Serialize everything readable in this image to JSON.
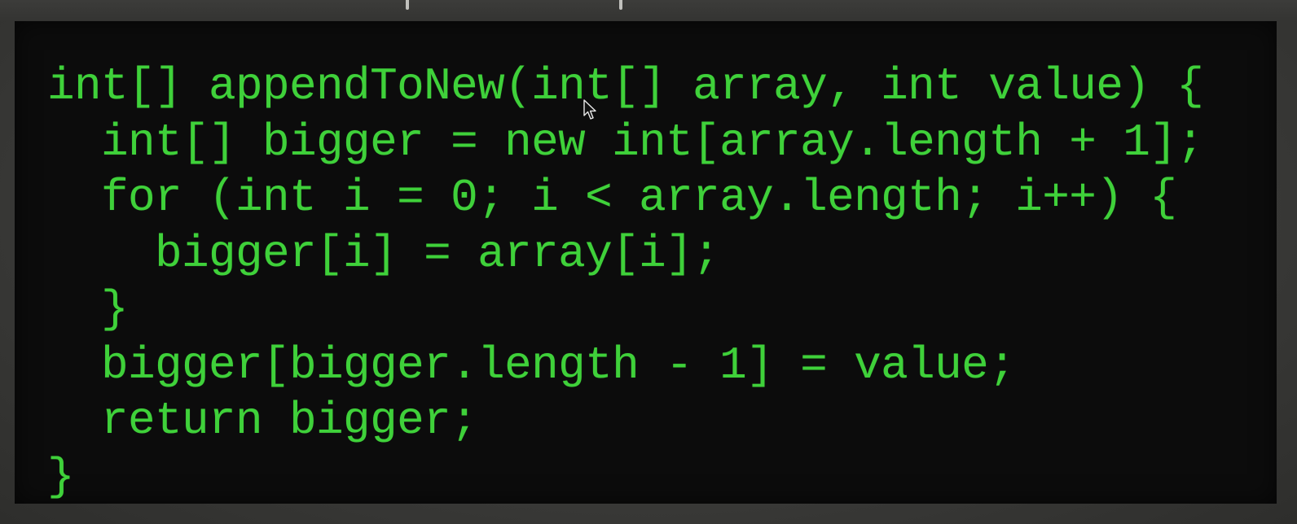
{
  "code": {
    "lines": [
      "int[] appendToNew(int[] array, int value) {",
      "  int[] bigger = new int[array.length + 1];",
      "  for (int i = 0; i < array.length; i++) {",
      "    bigger[i] = array[i];",
      "  }",
      "  bigger[bigger.length - 1] = value;",
      "  return bigger;",
      "}"
    ],
    "text_color": "#3fd13a",
    "background_color": "#0c0c0c"
  },
  "cursor": {
    "icon": "arrow-pointer-icon"
  }
}
